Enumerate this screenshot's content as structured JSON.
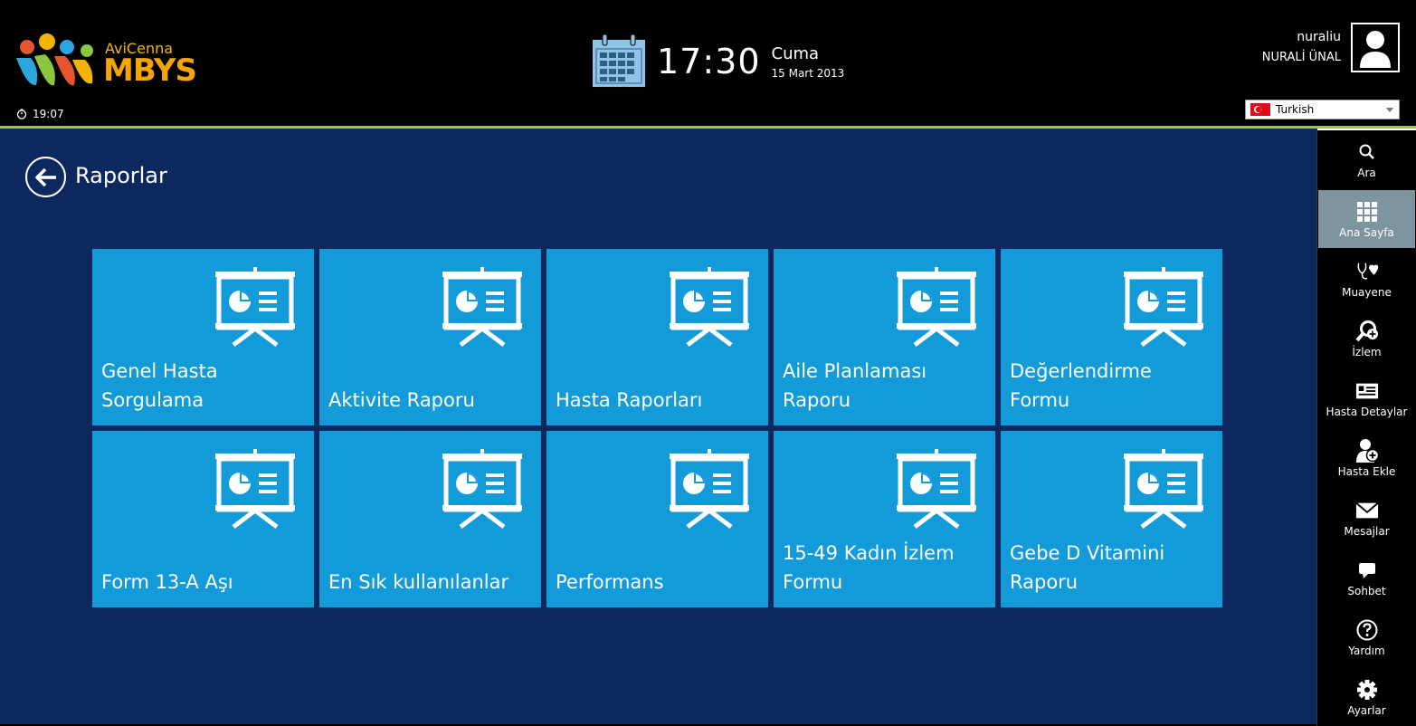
{
  "app": {
    "logo_brand": "AviCenna",
    "logo_name": "MBYS"
  },
  "header": {
    "login_time": "19:07",
    "time": "17:30",
    "day": "Cuma",
    "date": "15 Mart 2013",
    "username": "nuraliu",
    "fullname": "NURALİ ÜNAL",
    "language": "Turkish"
  },
  "page": {
    "title": "Raporlar"
  },
  "tiles": [
    {
      "label": "Genel Hasta\nSorgulama",
      "icon": "presentation-chart-icon"
    },
    {
      "label": "Aktivite Raporu",
      "icon": "presentation-chart-icon"
    },
    {
      "label": "Hasta Raporları",
      "icon": "presentation-chart-icon"
    },
    {
      "label": "Aile Planlaması\nRaporu",
      "icon": "presentation-chart-icon"
    },
    {
      "label": "Değerlendirme\nFormu",
      "icon": "presentation-chart-icon"
    },
    {
      "label": "Form 13-A Aşı",
      "icon": "presentation-chart-icon"
    },
    {
      "label": "En Sık kullanılanlar",
      "icon": "presentation-chart-icon"
    },
    {
      "label": "Performans",
      "icon": "presentation-chart-icon"
    },
    {
      "label": "15-49 Kadın İzlem\nFormu",
      "icon": "presentation-chart-icon"
    },
    {
      "label": "Gebe D Vitamini\nRaporu",
      "icon": "presentation-chart-icon"
    }
  ],
  "sidebar": {
    "items": [
      {
        "label": "Ara",
        "icon": "search-icon"
      },
      {
        "label": "Ana Sayfa",
        "icon": "grid-icon",
        "active": true
      },
      {
        "label": "Muayene",
        "icon": "stethoscope-heart-icon"
      },
      {
        "label": "İzlem",
        "icon": "magnify-plus-icon"
      },
      {
        "label": "Hasta Detaylar",
        "icon": "id-card-icon"
      },
      {
        "label": "Hasta Ekle",
        "icon": "add-user-icon"
      },
      {
        "label": "Mesajlar",
        "icon": "envelope-icon"
      },
      {
        "label": "Sohbet",
        "icon": "chat-bubble-icon"
      },
      {
        "label": "Yardım",
        "icon": "help-icon"
      },
      {
        "label": "Ayarlar",
        "icon": "gear-icon"
      }
    ]
  },
  "colors": {
    "header_bg": "#000000",
    "accent_line": "#9acd32",
    "main_bg": "#0c285e",
    "tile_bg": "#139bd9",
    "sidebar_active": "#7e949e"
  }
}
